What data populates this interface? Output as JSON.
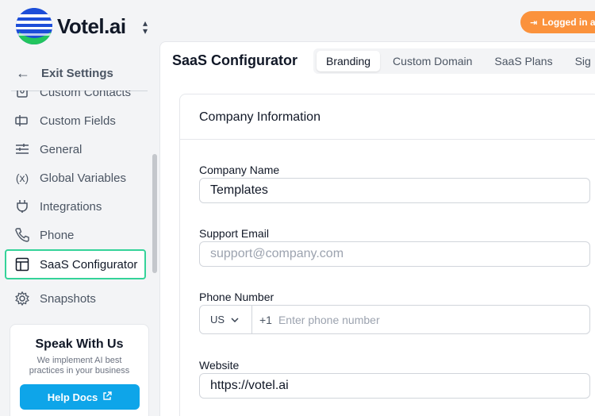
{
  "brand": {
    "name": "Votel.ai"
  },
  "topbar": {
    "switcher_icon": "chevron-up-down-icon",
    "logged_in_label": "Logged in a"
  },
  "sidebar": {
    "exit_label": "Exit Settings",
    "items": [
      {
        "label": "Custom Contacts",
        "icon": "contacts-icon"
      },
      {
        "label": "Custom Fields",
        "icon": "fields-icon"
      },
      {
        "label": "General",
        "icon": "sliders-icon"
      },
      {
        "label": "Global Variables",
        "icon": "variables-icon"
      },
      {
        "label": "Integrations",
        "icon": "plug-icon"
      },
      {
        "label": "Phone",
        "icon": "phone-icon"
      },
      {
        "label": "SaaS Configurator",
        "icon": "layout-icon",
        "active": true
      },
      {
        "label": "Snapshots",
        "icon": "gear-icon"
      }
    ],
    "promo": {
      "title": "Speak With Us",
      "description": "We implement AI best practices in your business",
      "button_label": "Help Docs"
    }
  },
  "main": {
    "title": "SaaS Configurator",
    "tabs": [
      {
        "label": "Branding",
        "active": true
      },
      {
        "label": "Custom Domain"
      },
      {
        "label": "SaaS Plans"
      },
      {
        "label": "Sig"
      }
    ],
    "card": {
      "title": "Company Information",
      "fields": {
        "company_name": {
          "label": "Company Name",
          "value": "Templates"
        },
        "support_email": {
          "label": "Support Email",
          "placeholder": "support@company.com"
        },
        "phone_number": {
          "label": "Phone Number",
          "country": "US",
          "dial_code": "+1",
          "placeholder": "Enter phone number"
        },
        "website": {
          "label": "Website",
          "value": "https://votel.ai"
        }
      }
    }
  },
  "colors": {
    "accent_green": "#34d399",
    "orange": "#fb923c",
    "sky": "#0ea5e9"
  }
}
